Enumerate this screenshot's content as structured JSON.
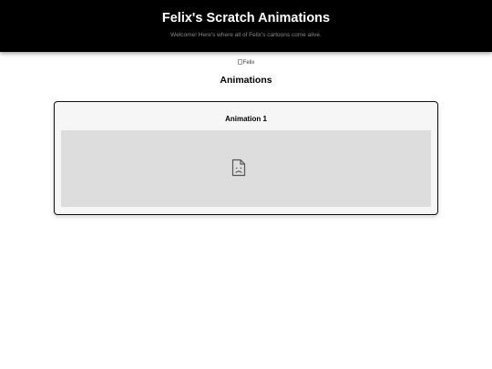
{
  "header": {
    "title": "Felix's Scratch Animations",
    "subtitle": "Welcome! Here's where all of Felix's cartoons come alive."
  },
  "profile_image": {
    "alt_text": "Felix"
  },
  "animations_section": {
    "heading": "Animations",
    "items": [
      {
        "title": "Animation 1",
        "embed_icon": "sad-page-icon"
      }
    ]
  }
}
